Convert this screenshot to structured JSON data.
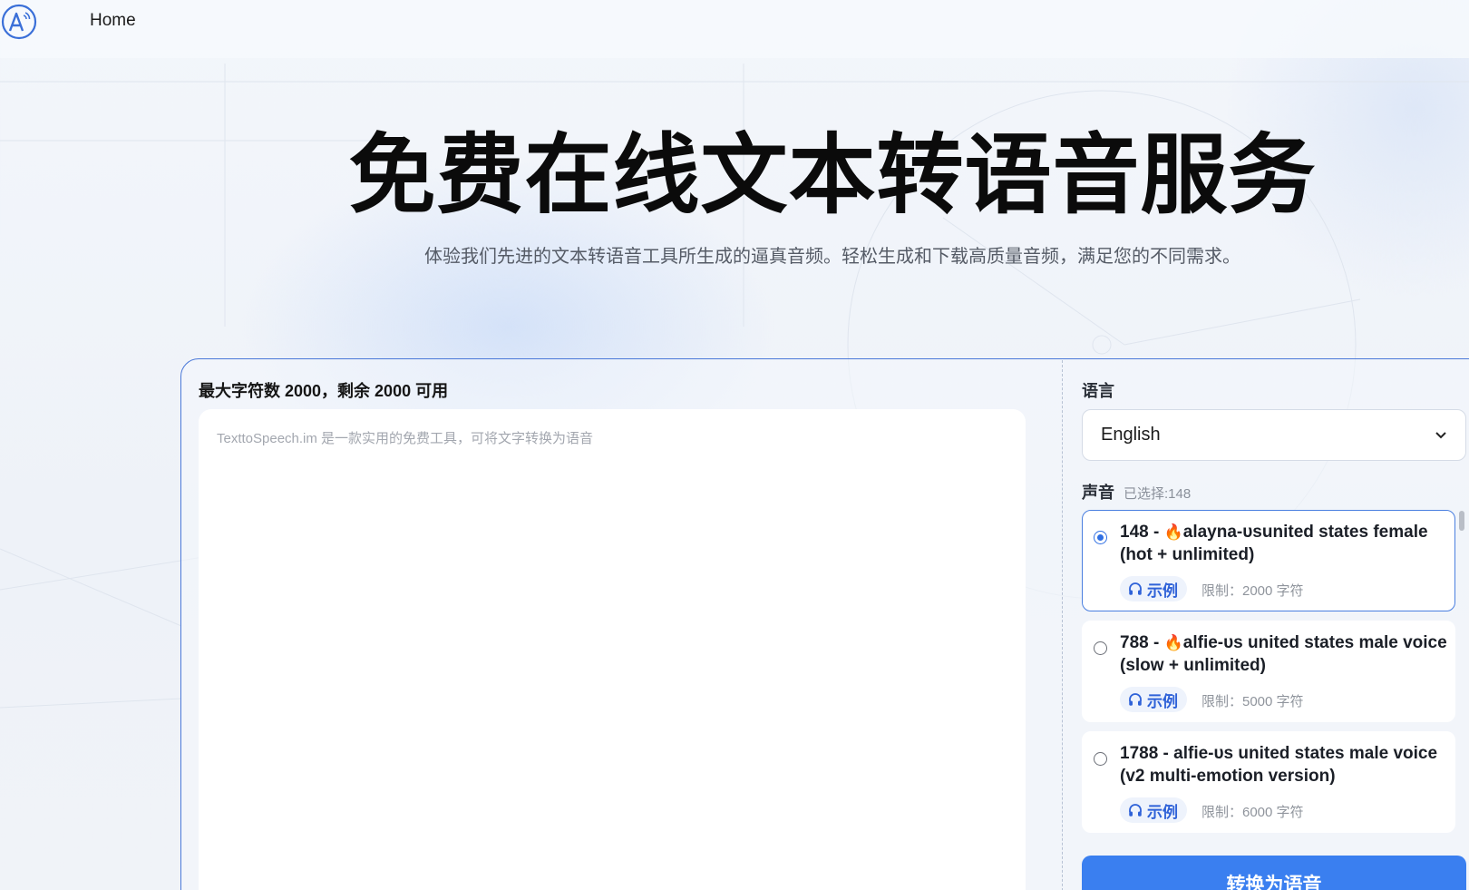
{
  "header": {
    "nav_home": "Home"
  },
  "hero": {
    "title": "免费在线文本转语音服务",
    "subtitle": "体验我们先进的文本转语音工具所生成的逼真音频。轻松生成和下载高质量音频，满足您的不同需求。"
  },
  "editor": {
    "char_count": "最大字符数 2000，剩余 2000 可用",
    "placeholder": "TexttoSpeech.im 是一款实用的免费工具，可将文字转换为语音",
    "value": ""
  },
  "language": {
    "label": "语言",
    "selected": "English"
  },
  "voice": {
    "label": "声音",
    "selected_text": "已选择:148",
    "items": [
      {
        "id_prefix": "148 - ",
        "hot": true,
        "name": "alayna-ᴜsunited states female (hot + unlimited)",
        "sample_label": "示例",
        "limit": "限制：2000 字符",
        "selected": true
      },
      {
        "id_prefix": "788 - ",
        "hot": true,
        "name": "alfie-ᴜs united states male voice (slow + unlimited)",
        "sample_label": "示例",
        "limit": "限制：5000 字符",
        "selected": false
      },
      {
        "id_prefix": "1788 - ",
        "hot": false,
        "name": "alfie-ᴜs united states male voice (v2 multi-emotion version)",
        "sample_label": "示例",
        "limit": "限制：6000 字符",
        "selected": false
      }
    ]
  },
  "convert": {
    "label": "转换为语音"
  },
  "icons": {
    "logo": "logo-a-sound-icon",
    "hot": "fire-icon",
    "sample": "headphones-icon",
    "select": "chevron-down-icon"
  },
  "colors": {
    "accent": "#3a7ff0",
    "border_accent": "#4a78d8",
    "sample_text": "#2f62d8",
    "hot": "#f07b1a"
  }
}
